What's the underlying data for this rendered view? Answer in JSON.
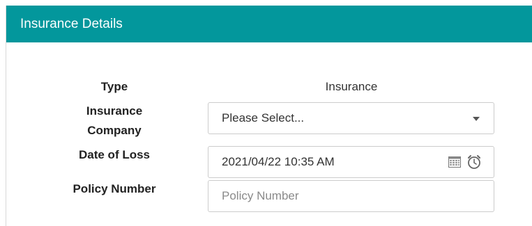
{
  "panel": {
    "title": "Insurance Details"
  },
  "form": {
    "type": {
      "label": "Type",
      "value": "Insurance"
    },
    "insurance_company": {
      "label_line1": "Insurance",
      "label_line2": "Company",
      "selected": "Please Select..."
    },
    "date_of_loss": {
      "label": "Date of Loss",
      "value": "2021/04/22 10:35 AM"
    },
    "policy_number": {
      "label": "Policy Number",
      "value": "",
      "placeholder": "Policy Number"
    }
  },
  "icons": {
    "calendar": "calendar-icon",
    "clock": "clock-icon",
    "dropdown": "chevron-down-icon"
  },
  "colors": {
    "header_bg": "#03979c",
    "header_text": "#ffffff"
  }
}
